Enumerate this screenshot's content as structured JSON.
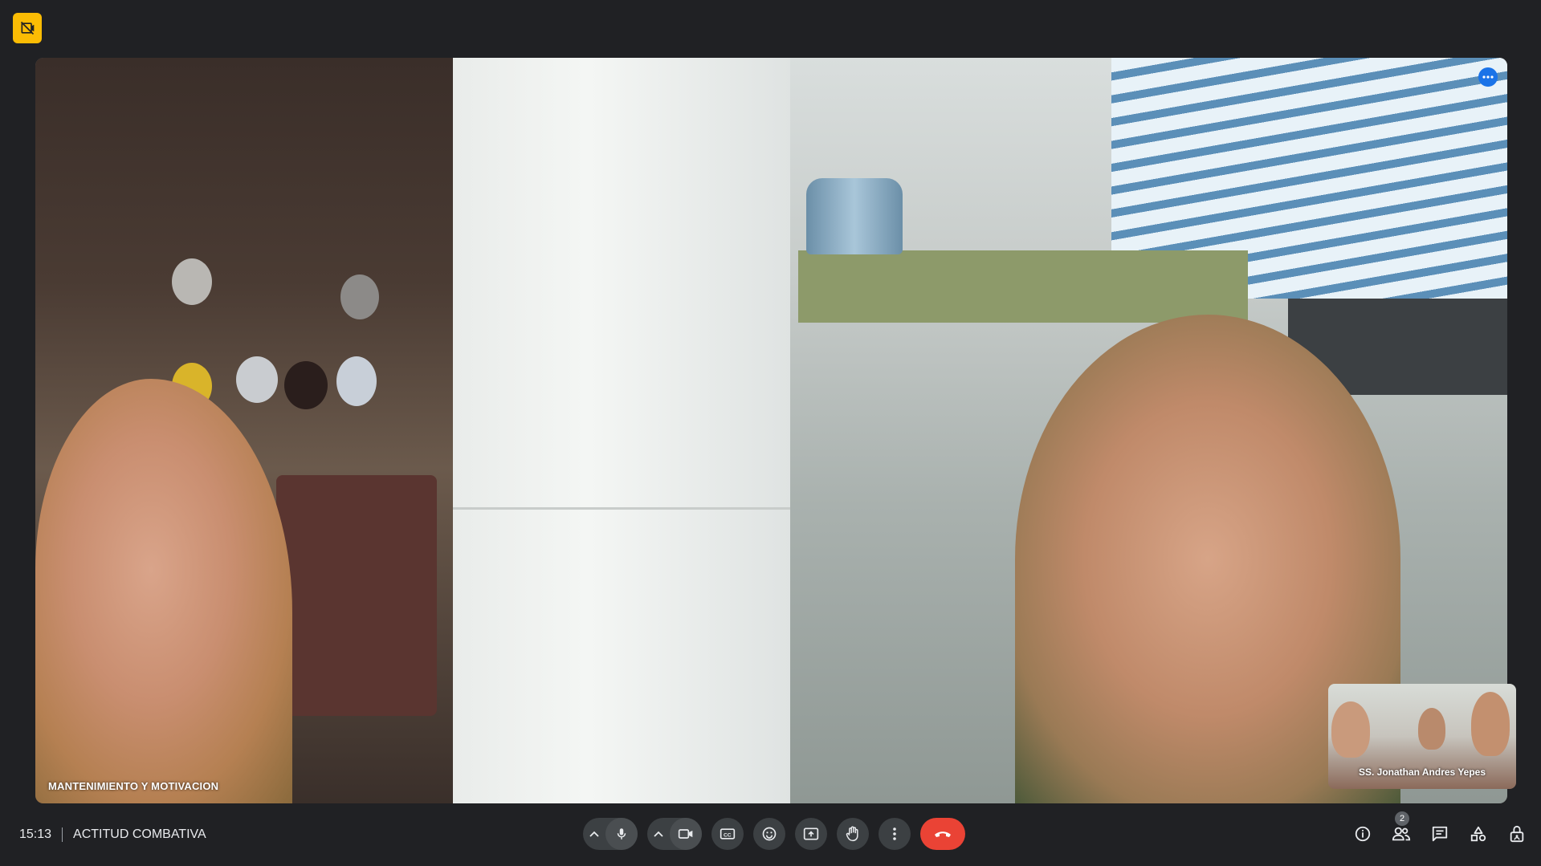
{
  "main_tile": {
    "participant_name": "MANTENIMIENTO Y MOTIVACION"
  },
  "self_view": {
    "participant_name": "SS. Jonathan Andres Yepes"
  },
  "meeting": {
    "time": "15:13",
    "title": "ACTITUD COMBATIVA"
  },
  "people": {
    "count": "2"
  },
  "icons": {
    "recording": "recording-off-icon",
    "more": "more-options-icon",
    "mic": "microphone-icon",
    "camera": "camera-icon",
    "captions": "captions-icon",
    "emoji": "emoji-icon",
    "present": "present-screen-icon",
    "hand": "raise-hand-icon",
    "menu": "more-vert-icon",
    "hangup": "hang-up-icon",
    "info": "info-icon",
    "people": "people-icon",
    "chat": "chat-icon",
    "activities": "activities-icon",
    "host": "host-controls-icon"
  },
  "colors": {
    "background": "#202124",
    "hangup": "#ea4335",
    "recording_badge": "#fbbc04",
    "accent": "#1a73e8"
  }
}
